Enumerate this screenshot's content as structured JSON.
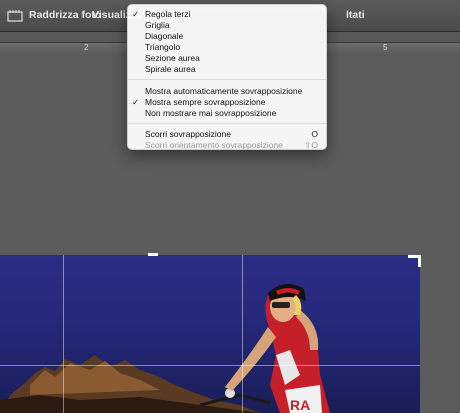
{
  "toolbar": {
    "straighten_label": "Raddrizza foto",
    "view_label": "Visualizza",
    "right_label": "ltati"
  },
  "ruler": {
    "labels": [
      "2",
      "5"
    ]
  },
  "overlay_menu": {
    "guides": [
      {
        "label": "Regola terzi",
        "checked": true
      },
      {
        "label": "Griglia",
        "checked": false
      },
      {
        "label": "Diagonale",
        "checked": false
      },
      {
        "label": "Triangolo",
        "checked": false
      },
      {
        "label": "Sezione aurea",
        "checked": false
      },
      {
        "label": "Spirale aurea",
        "checked": false
      }
    ],
    "display_modes": [
      {
        "label": "Mostra automaticamente sovrapposizione",
        "checked": false
      },
      {
        "label": "Mostra sempre sovrapposizione",
        "checked": true
      },
      {
        "label": "Non mostrare mai sovrapposizione",
        "checked": false
      }
    ],
    "cycle_overlay": {
      "label": "Scorri sovrapposizione",
      "shortcut": "O",
      "enabled": true
    },
    "cycle_orientation": {
      "label": "Scorri orientamento sovrapposizione",
      "shortcut": "⇧O",
      "enabled": false
    },
    "checkmark": "✓"
  },
  "colors": {
    "app_background": "#585858",
    "sky": "#2b2d85",
    "menu_background": "#fafafa"
  }
}
